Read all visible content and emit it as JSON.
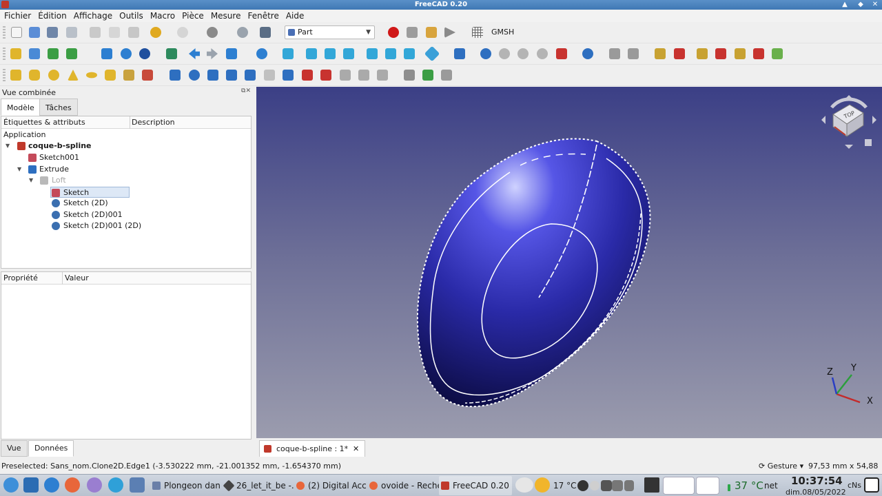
{
  "window": {
    "title": "FreeCAD 0.20"
  },
  "menu": [
    "Fichier",
    "Édition",
    "Affichage",
    "Outils",
    "Macro",
    "Pièce",
    "Mesure",
    "Fenêtre",
    "Aide"
  ],
  "workbench": {
    "selected": "Part",
    "gmsh_label": "GMSH"
  },
  "combo_view": {
    "title": "Vue combinée",
    "tabs": [
      "Modèle",
      "Tâches"
    ],
    "tree_headers": [
      "Étiquettes & attributs",
      "Description"
    ],
    "tree": {
      "section": "Application",
      "document": "coque-b-spline",
      "items": [
        "Sketch001",
        "Extrude",
        "Loft",
        "Sketch",
        "Sketch (2D)",
        "Sketch (2D)001",
        "Sketch (2D)001 (2D)"
      ]
    },
    "prop_headers": [
      "Propriété",
      "Valeur"
    ],
    "bottom_tabs": [
      "Vue",
      "Données"
    ]
  },
  "view_tab": {
    "label": "coque-b-spline : 1*",
    "close": "✕"
  },
  "navcube": {
    "face": "TOP"
  },
  "axes": {
    "x": "X",
    "y": "Y",
    "z": "Z"
  },
  "status": {
    "preselected": "Preselected: Sans_nom.Clone2D.Edge1 (-3.530222 mm, -21.001352 mm, -1.654370 mm)",
    "nav_style": "Gesture",
    "dimensions": "97,53 mm x 54,88 mm"
  },
  "taskbar": {
    "tasks": [
      "Plongeon dan...",
      "26_let_it_be -...",
      "(2) Digital Acc...",
      "ovoide - Reche...",
      "FreeCAD 0.20"
    ],
    "weather_small": "17 °C",
    "weather_big": "37 °C",
    "net": "net",
    "time": "10:37:54",
    "date": "dim.08/05/2022",
    "kb": "cNs"
  },
  "colors": {
    "shell": "#3434d0",
    "bg_top": "#3b3f86",
    "bg_bottom": "#9b9cae"
  }
}
